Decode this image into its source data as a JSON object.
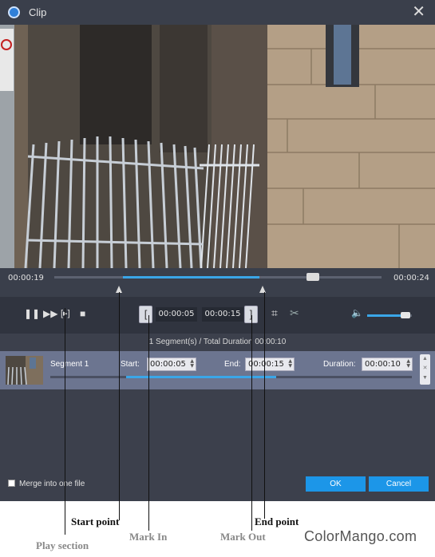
{
  "window": {
    "title": "Clip"
  },
  "timeline": {
    "current_time": "00:00:19",
    "total_time": "00:00:24"
  },
  "controls": {
    "start_time": "00:00:05",
    "end_time": "00:00:15",
    "volume_fraction": 0.85
  },
  "segment_info": "1 Segment(s) / Total Duration 00:00:10",
  "segment": {
    "name": "Segment 1",
    "start_label": "Start:",
    "start_value": "00:00:05",
    "end_label": "End:",
    "end_value": "00:00:15",
    "duration_label": "Duration:",
    "duration_value": "00:00:10"
  },
  "footer": {
    "merge_label": "Merge into one file",
    "ok_label": "OK",
    "cancel_label": "Cancel"
  },
  "annotations": {
    "start_point": "Start point",
    "end_point": "End point",
    "play_section": "Play section",
    "mark_in": "Mark In",
    "mark_out": "Mark Out"
  },
  "watermark": {
    "text": "ColorMango.com"
  },
  "colors": {
    "accent": "#1c96e8",
    "progress": "#3aa6e8",
    "panel": "#3c404c"
  }
}
